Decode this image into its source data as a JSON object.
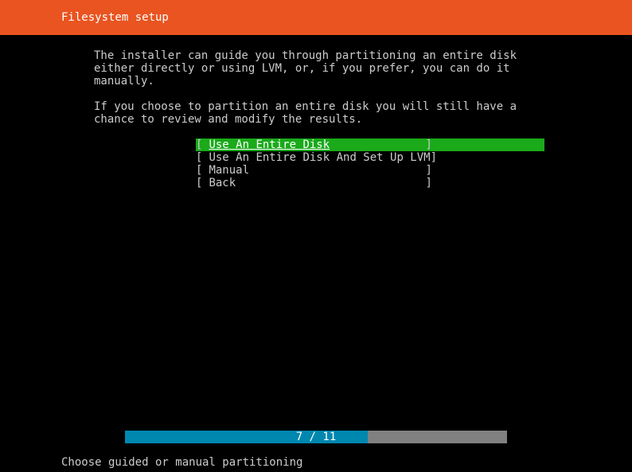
{
  "header": {
    "title": "Filesystem setup"
  },
  "description": {
    "para1": "The installer can guide you through partitioning an entire disk either directly or using LVM, or, if you prefer, you can do it manually.",
    "para2": "If you choose to partition an entire disk you will still have a chance to review and modify the results."
  },
  "menu": {
    "items": [
      {
        "label": "Use An Entire Disk",
        "selected": true
      },
      {
        "label": "Use An Entire Disk And Set Up LVM",
        "selected": false
      },
      {
        "label": "Manual",
        "selected": false
      },
      {
        "label": "Back",
        "selected": false
      }
    ]
  },
  "progress": {
    "current": 7,
    "total": 11,
    "text": "7 / 11"
  },
  "status": {
    "text": "Choose guided or manual partitioning"
  }
}
